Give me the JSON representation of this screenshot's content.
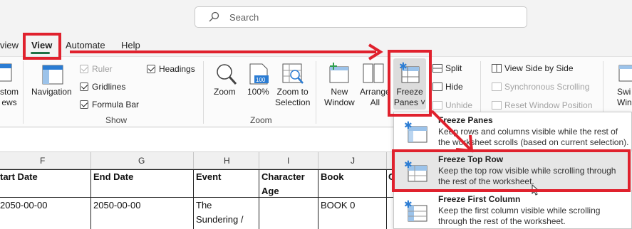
{
  "search": {
    "placeholder": "Search"
  },
  "tabs": [
    {
      "label": "view",
      "active": false
    },
    {
      "label": "View",
      "active": true
    },
    {
      "label": "Automate",
      "active": false
    },
    {
      "label": "Help",
      "active": false
    }
  ],
  "ribbon": {
    "custom_views_line1": "stom",
    "custom_views_line2": "ews",
    "navigation": "Navigation",
    "ruler": "Ruler",
    "gridlines": "Gridlines",
    "formula_bar": "Formula Bar",
    "headings": "Headings",
    "show_group": "Show",
    "zoom": "Zoom",
    "zoom100": "100%",
    "zoom_to_selection_1": "Zoom to",
    "zoom_to_selection_2": "Selection",
    "zoom_group": "Zoom",
    "new_window_1": "New",
    "new_window_2": "Window",
    "arrange_all_1": "Arrange",
    "arrange_all_2": "All",
    "freeze_panes_1": "Freeze",
    "freeze_panes_2": "Panes ˅",
    "split": "Split",
    "hide": "Hide",
    "unhide": "Unhide",
    "view_side_by_side": "View Side by Side",
    "synchronous_scrolling": "Synchronous Scrolling",
    "reset_window_position": "Reset Window Position",
    "switch_windows_1": "Swi",
    "switch_windows_2": "Windo"
  },
  "columns": [
    "F",
    "G",
    "H",
    "I",
    "J"
  ],
  "table": {
    "headers": [
      "tart Date",
      "End Date",
      "Event",
      "Character Age",
      "Book",
      "C"
    ],
    "row1": [
      "2050-00-00",
      "2050-00-00",
      "The Sundering /",
      "",
      "BOOK 0"
    ]
  },
  "dropdown": {
    "items": [
      {
        "title": "Freeze Panes",
        "desc": "Keep rows and columns visible while the rest of the worksheet scrolls (based on current selection)."
      },
      {
        "title": "Freeze Top Row",
        "desc": "Keep the top row visible while scrolling through the rest of the worksheet."
      },
      {
        "title": "Freeze First Column",
        "desc": "Keep the first column visible while scrolling through the rest of the worksheet."
      }
    ]
  },
  "colors": {
    "annotation_red": "#e0212d",
    "excel_green": "#1f7145",
    "icon_blue": "#2b7cd3"
  }
}
